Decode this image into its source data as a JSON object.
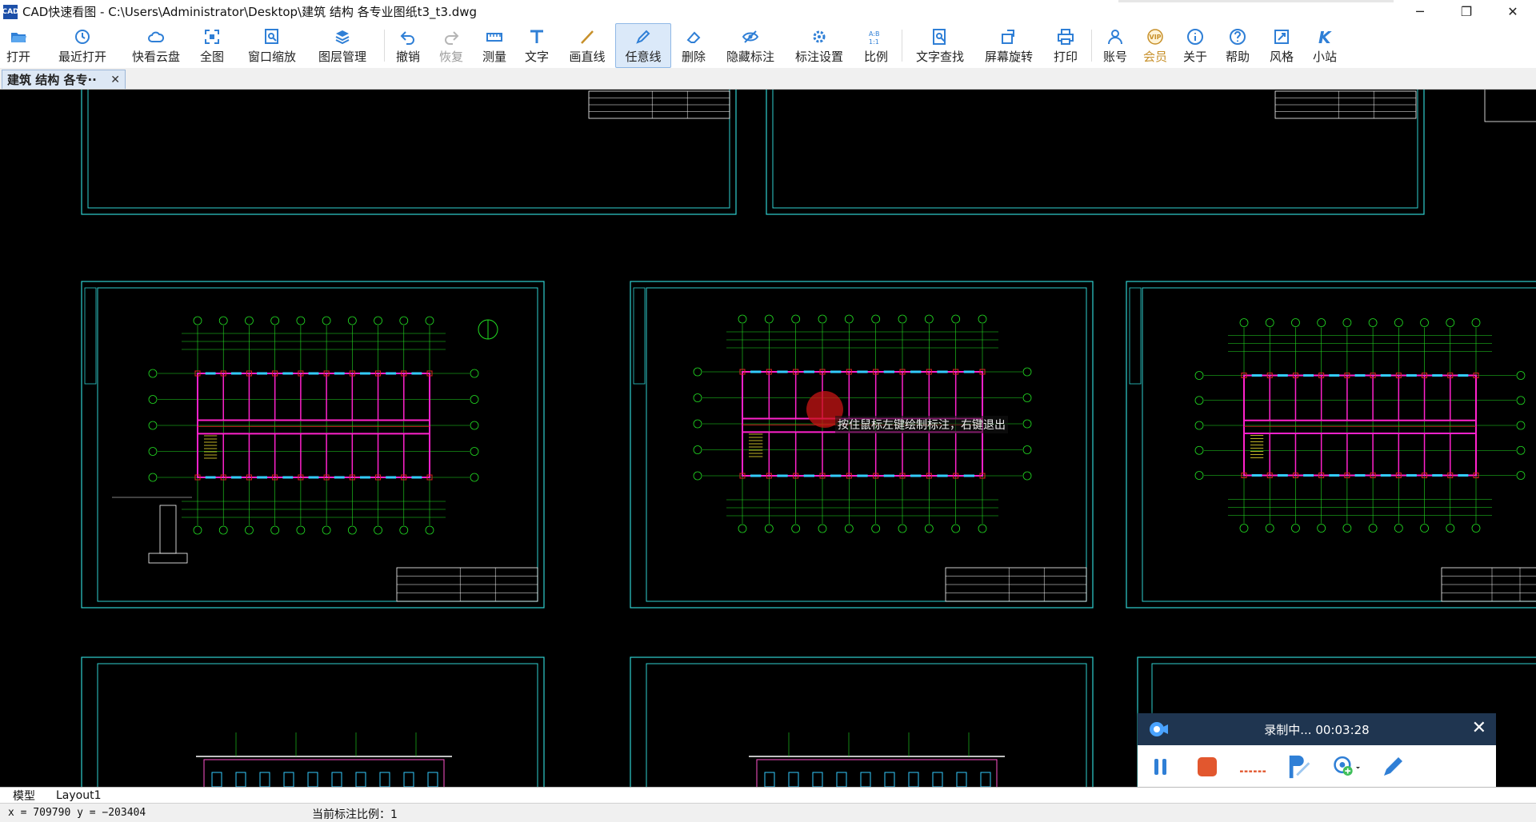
{
  "window": {
    "app_icon_text": "CAD",
    "title": "CAD快速看图 - C:\\Users\\Administrator\\Desktop\\建筑 结构 各专业图纸t3_t3.dwg",
    "minimize_glyph": "─",
    "maximize_glyph": "❐",
    "close_glyph": "✕"
  },
  "toolbar": {
    "open": "打开",
    "recent": "最近打开",
    "cloud": "快看云盘",
    "fit_all": "全图",
    "window_zoom": "窗口缩放",
    "layers": "图层管理",
    "undo": "撤销",
    "redo": "恢复",
    "measure": "测量",
    "text": "文字",
    "line": "画直线",
    "freehand": "任意线",
    "erase": "删除",
    "hide_marks": "隐藏标注",
    "mark_settings": "标注设置",
    "scale": "比例",
    "find_text": "文字查找",
    "rotate": "屏幕旋转",
    "print": "打印",
    "account": "账号",
    "vip": "会员",
    "about": "关于",
    "help": "帮助",
    "style": "风格",
    "site": "小站"
  },
  "tabs": {
    "doc_tab_label": "建筑 结构 各专··",
    "doc_tab_close": "✕"
  },
  "canvas": {
    "cursor_hint": "按住鼠标左键绘制标注，右键退出"
  },
  "recorder": {
    "status": "录制中... 00:03:28",
    "close_glyph": "✕"
  },
  "layout_tabs": {
    "model": "模型",
    "layout1": "Layout1"
  },
  "status": {
    "coords": "x = 709790  y = −203404",
    "scale_label": "当前标注比例：1"
  },
  "colors": {
    "canvas_bg": "#000000",
    "frame": "#2fd0d0",
    "grid_green": "#22dd22",
    "wall_magenta": "#ff22cc",
    "axis_red": "#dd2222",
    "recorder_header": "#1f3550"
  }
}
